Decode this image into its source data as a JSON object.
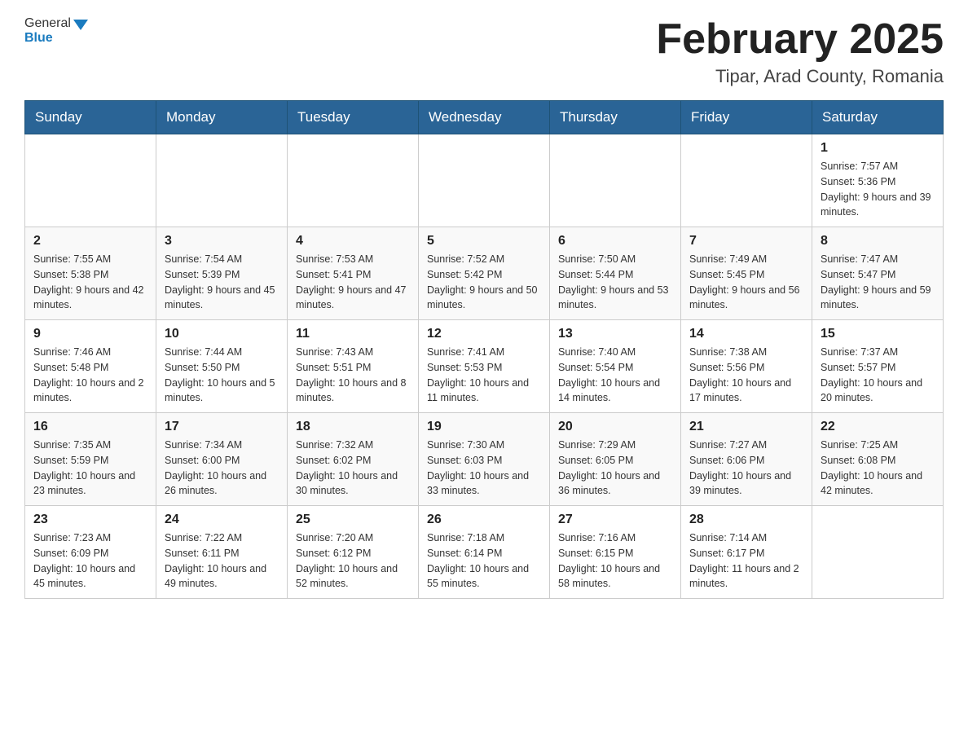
{
  "header": {
    "logo_general": "General",
    "logo_blue": "Blue",
    "month_title": "February 2025",
    "location": "Tipar, Arad County, Romania"
  },
  "days_of_week": [
    "Sunday",
    "Monday",
    "Tuesday",
    "Wednesday",
    "Thursday",
    "Friday",
    "Saturday"
  ],
  "weeks": [
    [
      {
        "day": "",
        "info": ""
      },
      {
        "day": "",
        "info": ""
      },
      {
        "day": "",
        "info": ""
      },
      {
        "day": "",
        "info": ""
      },
      {
        "day": "",
        "info": ""
      },
      {
        "day": "",
        "info": ""
      },
      {
        "day": "1",
        "info": "Sunrise: 7:57 AM\nSunset: 5:36 PM\nDaylight: 9 hours and 39 minutes."
      }
    ],
    [
      {
        "day": "2",
        "info": "Sunrise: 7:55 AM\nSunset: 5:38 PM\nDaylight: 9 hours and 42 minutes."
      },
      {
        "day": "3",
        "info": "Sunrise: 7:54 AM\nSunset: 5:39 PM\nDaylight: 9 hours and 45 minutes."
      },
      {
        "day": "4",
        "info": "Sunrise: 7:53 AM\nSunset: 5:41 PM\nDaylight: 9 hours and 47 minutes."
      },
      {
        "day": "5",
        "info": "Sunrise: 7:52 AM\nSunset: 5:42 PM\nDaylight: 9 hours and 50 minutes."
      },
      {
        "day": "6",
        "info": "Sunrise: 7:50 AM\nSunset: 5:44 PM\nDaylight: 9 hours and 53 minutes."
      },
      {
        "day": "7",
        "info": "Sunrise: 7:49 AM\nSunset: 5:45 PM\nDaylight: 9 hours and 56 minutes."
      },
      {
        "day": "8",
        "info": "Sunrise: 7:47 AM\nSunset: 5:47 PM\nDaylight: 9 hours and 59 minutes."
      }
    ],
    [
      {
        "day": "9",
        "info": "Sunrise: 7:46 AM\nSunset: 5:48 PM\nDaylight: 10 hours and 2 minutes."
      },
      {
        "day": "10",
        "info": "Sunrise: 7:44 AM\nSunset: 5:50 PM\nDaylight: 10 hours and 5 minutes."
      },
      {
        "day": "11",
        "info": "Sunrise: 7:43 AM\nSunset: 5:51 PM\nDaylight: 10 hours and 8 minutes."
      },
      {
        "day": "12",
        "info": "Sunrise: 7:41 AM\nSunset: 5:53 PM\nDaylight: 10 hours and 11 minutes."
      },
      {
        "day": "13",
        "info": "Sunrise: 7:40 AM\nSunset: 5:54 PM\nDaylight: 10 hours and 14 minutes."
      },
      {
        "day": "14",
        "info": "Sunrise: 7:38 AM\nSunset: 5:56 PM\nDaylight: 10 hours and 17 minutes."
      },
      {
        "day": "15",
        "info": "Sunrise: 7:37 AM\nSunset: 5:57 PM\nDaylight: 10 hours and 20 minutes."
      }
    ],
    [
      {
        "day": "16",
        "info": "Sunrise: 7:35 AM\nSunset: 5:59 PM\nDaylight: 10 hours and 23 minutes."
      },
      {
        "day": "17",
        "info": "Sunrise: 7:34 AM\nSunset: 6:00 PM\nDaylight: 10 hours and 26 minutes."
      },
      {
        "day": "18",
        "info": "Sunrise: 7:32 AM\nSunset: 6:02 PM\nDaylight: 10 hours and 30 minutes."
      },
      {
        "day": "19",
        "info": "Sunrise: 7:30 AM\nSunset: 6:03 PM\nDaylight: 10 hours and 33 minutes."
      },
      {
        "day": "20",
        "info": "Sunrise: 7:29 AM\nSunset: 6:05 PM\nDaylight: 10 hours and 36 minutes."
      },
      {
        "day": "21",
        "info": "Sunrise: 7:27 AM\nSunset: 6:06 PM\nDaylight: 10 hours and 39 minutes."
      },
      {
        "day": "22",
        "info": "Sunrise: 7:25 AM\nSunset: 6:08 PM\nDaylight: 10 hours and 42 minutes."
      }
    ],
    [
      {
        "day": "23",
        "info": "Sunrise: 7:23 AM\nSunset: 6:09 PM\nDaylight: 10 hours and 45 minutes."
      },
      {
        "day": "24",
        "info": "Sunrise: 7:22 AM\nSunset: 6:11 PM\nDaylight: 10 hours and 49 minutes."
      },
      {
        "day": "25",
        "info": "Sunrise: 7:20 AM\nSunset: 6:12 PM\nDaylight: 10 hours and 52 minutes."
      },
      {
        "day": "26",
        "info": "Sunrise: 7:18 AM\nSunset: 6:14 PM\nDaylight: 10 hours and 55 minutes."
      },
      {
        "day": "27",
        "info": "Sunrise: 7:16 AM\nSunset: 6:15 PM\nDaylight: 10 hours and 58 minutes."
      },
      {
        "day": "28",
        "info": "Sunrise: 7:14 AM\nSunset: 6:17 PM\nDaylight: 11 hours and 2 minutes."
      },
      {
        "day": "",
        "info": ""
      }
    ]
  ]
}
